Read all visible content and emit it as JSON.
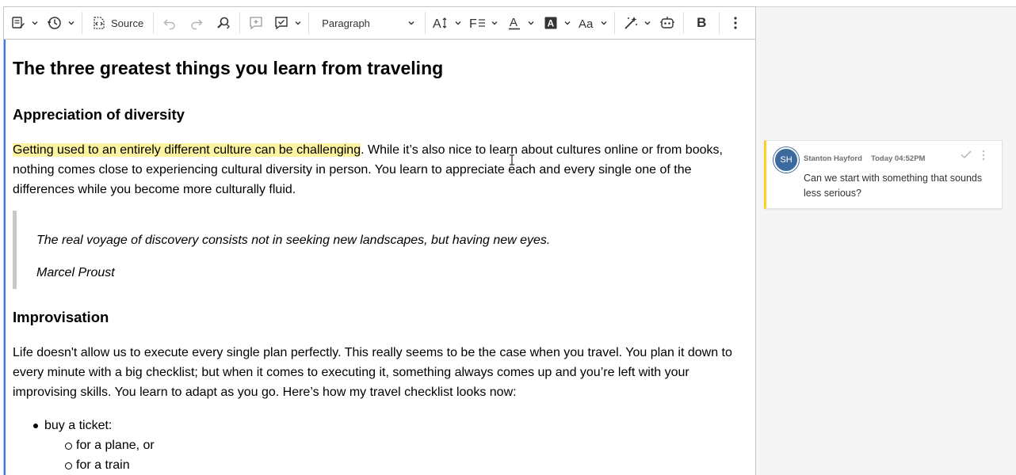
{
  "toolbar": {
    "source_label": "Source",
    "heading_select_value": "Paragraph",
    "bold_label": "B"
  },
  "document": {
    "title": "The three greatest things you learn from traveling",
    "section1_heading": "Appreciation of diversity",
    "p1_highlighted": "Getting used to an entirely different culture can be challenging",
    "p1_rest": ". While it’s also nice to learn about cultures online or from books, nothing comes close to experiencing cultural diversity in person. You learn to appreciate each and every single one of the differences while you become more culturally fluid.",
    "quote_text": "The real voyage of discovery consists not in seeking new landscapes, but having new eyes.",
    "quote_author": "Marcel Proust",
    "section2_heading": "Improvisation",
    "p2": "Life doesn't allow us to execute every single plan perfectly. This really seems to be the case when you travel. You plan it down to every minute with a big checklist; but when it comes to executing it, something always comes up and you’re left with your improvising skills. You learn to adapt as you go. Here’s how my travel checklist looks now:",
    "list": {
      "item1": "buy a ticket:",
      "sub1": "for a plane, or",
      "sub2": "for a train"
    }
  },
  "comment": {
    "initials": "SH",
    "author": "Stanton Hayford",
    "time": "Today 04:52PM",
    "text": "Can we start with something that sounds less serious?"
  },
  "colors": {
    "highlight": "#fcf3a1",
    "focus_border": "#2977ff",
    "comment_marker": "#ffd21f",
    "avatar": "#3d6a9e"
  }
}
